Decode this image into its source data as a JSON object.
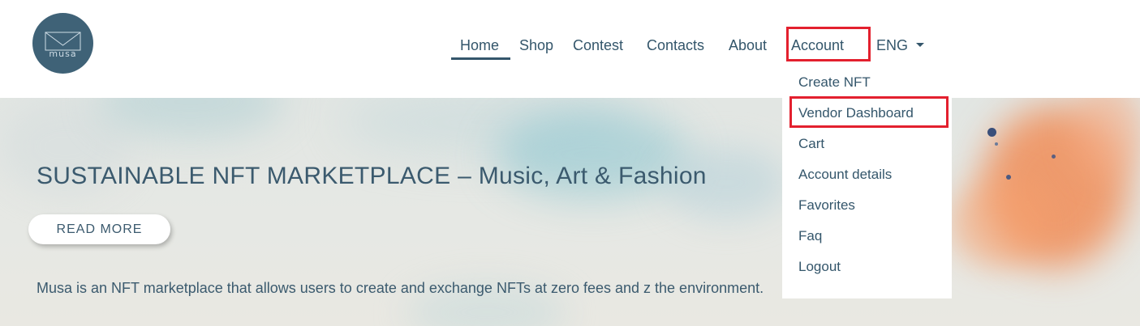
{
  "brand": {
    "logo_text": "musa"
  },
  "nav": {
    "home": "Home",
    "shop": "Shop",
    "contest": "Contest",
    "contacts": "Contacts",
    "about": "About",
    "account": "Account",
    "language": "ENG"
  },
  "account_menu": {
    "items": [
      "Create NFT",
      "Vendor Dashboard",
      "Cart",
      "Account details",
      "Favorites",
      "Faq",
      "Logout"
    ]
  },
  "hero": {
    "title": "SUSTAINABLE NFT MARKETPLACE – Music, Art & Fashion",
    "button": "READ MORE",
    "description": "Musa is an NFT marketplace that allows users to create and exchange NFTs at zero fees and z the environment."
  },
  "colors": {
    "primary": "#34566b",
    "logo_bg": "#3f6277",
    "highlight": "#e3202e",
    "accent_orange": "#f28246"
  }
}
